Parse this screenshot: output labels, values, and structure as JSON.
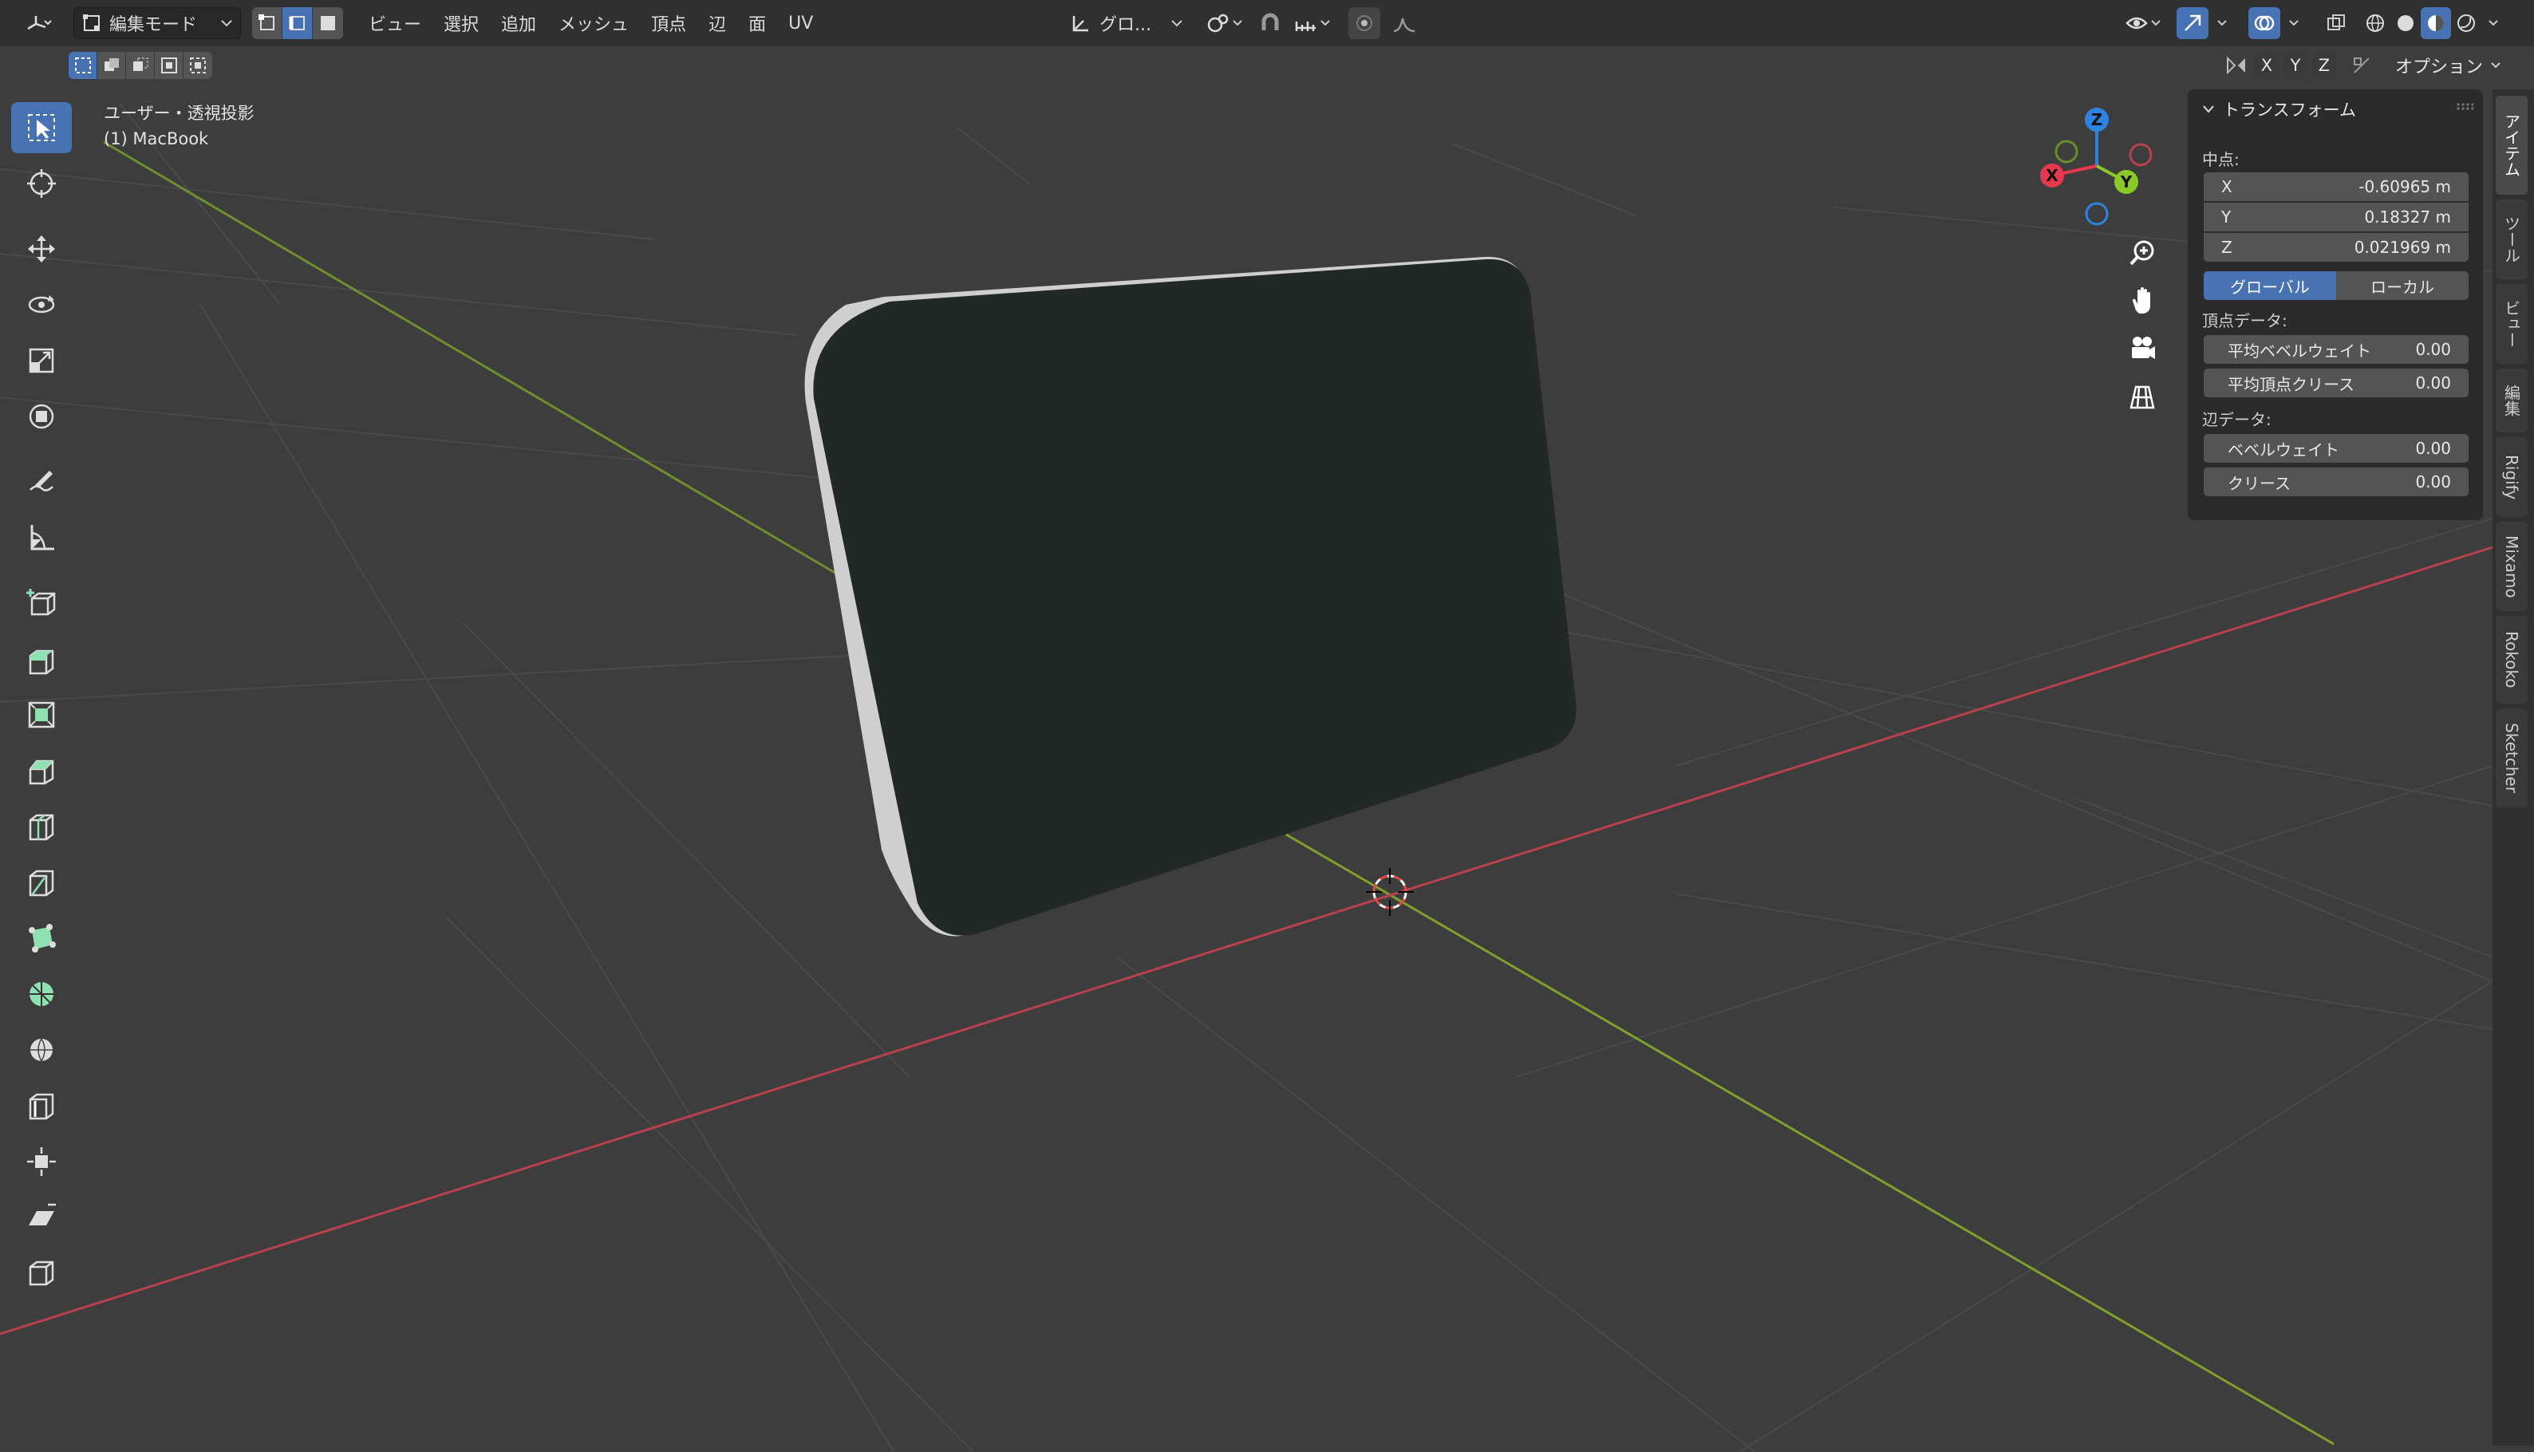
{
  "header": {
    "mode": "編集モード",
    "menus": [
      "ビュー",
      "選択",
      "追加",
      "メッシュ",
      "頂点",
      "辺",
      "面",
      "UV"
    ],
    "transform_orientation": "グロ..."
  },
  "axis_lock": {
    "x": "X",
    "y": "Y",
    "z": "Z"
  },
  "options_label": "オプション",
  "viewport": {
    "view_name": "ユーザー・透視投影",
    "object_name": "(1) MacBook"
  },
  "gizmo": {
    "x": "X",
    "y": "Y",
    "z": "Z"
  },
  "transform_panel": {
    "title": "トランスフォーム",
    "median_label": "中点:",
    "x": {
      "label": "X",
      "value": "-0.60965 m"
    },
    "y": {
      "label": "Y",
      "value": "0.18327 m"
    },
    "z": {
      "label": "Z",
      "value": "0.021969 m"
    },
    "space_global": "グローバル",
    "space_local": "ローカル",
    "vertex_data_label": "頂点データ:",
    "mean_bevel_weight": {
      "label": "平均ベベルウェイト",
      "value": "0.00"
    },
    "mean_vertex_crease": {
      "label": "平均頂点クリース",
      "value": "0.00"
    },
    "edge_data_label": "辺データ:",
    "bevel_weight": {
      "label": "ベベルウェイト",
      "value": "0.00"
    },
    "crease": {
      "label": "クリース",
      "value": "0.00"
    }
  },
  "side_tabs": [
    "アイテム",
    "ツール",
    "ビュー",
    "編集",
    "Rigify",
    "Mixamo",
    "Rokoko",
    "Sketcher"
  ],
  "colors": {
    "accent": "#4772b3",
    "axis_x": "#e8384f",
    "axis_y": "#8ac926",
    "axis_z": "#2f83e0",
    "mesh": "#222826"
  }
}
